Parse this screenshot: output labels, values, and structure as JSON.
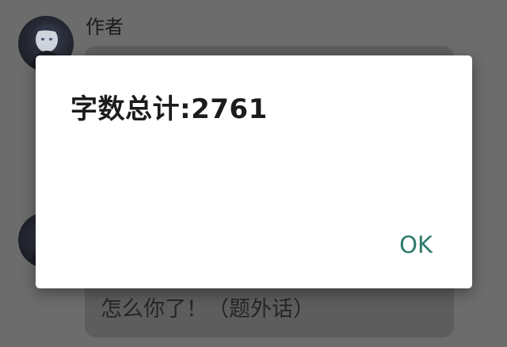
{
  "chat": {
    "author_label": "作者",
    "second_message_text": "怎么你了！（题外话）"
  },
  "dialog": {
    "title": "字数总计:2761",
    "ok_label": "OK"
  },
  "colors": {
    "scrim": "#6c6c6c",
    "dialog_bg": "#ffffff",
    "ok_accent": "#2a7a6a"
  }
}
